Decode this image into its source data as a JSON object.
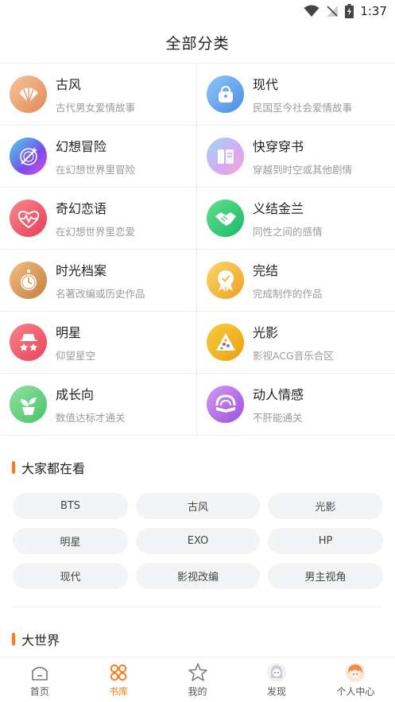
{
  "status_bar": {
    "time": "1:37"
  },
  "header": {
    "title": "全部分类"
  },
  "categories": [
    {
      "title": "古风",
      "desc": "古代男女爱情故事",
      "icon": "shell-icon",
      "color": "#f0a070"
    },
    {
      "title": "现代",
      "desc": "民国至今社会爱情故事",
      "icon": "handbag-icon",
      "color": "#6aaef0"
    },
    {
      "title": "幻想冒险",
      "desc": "在幻想世界里冒险",
      "icon": "magic-circle-icon",
      "color": "#6a5cf0"
    },
    {
      "title": "快穿穿书",
      "desc": "穿越到时空或其他剧情",
      "icon": "books-icon",
      "color": "#c9a8f0"
    },
    {
      "title": "奇幻恋语",
      "desc": "在幻想世界里恋爱",
      "icon": "heartbeat-icon",
      "color": "#f05a6a"
    },
    {
      "title": "义结金兰",
      "desc": "同性之间的感情",
      "icon": "handshake-icon",
      "color": "#3ed07a"
    },
    {
      "title": "时光档案",
      "desc": "名著改编或历史作品",
      "icon": "pocket-watch-icon",
      "color": "#d89a58"
    },
    {
      "title": "完结",
      "desc": "完成制作的作品",
      "icon": "medal-icon",
      "color": "#f5b930"
    },
    {
      "title": "明星",
      "desc": "仰望星空",
      "icon": "star-hat-icon",
      "color": "#f06470"
    },
    {
      "title": "光影",
      "desc": "影视ACG音乐合区",
      "icon": "palette-icon",
      "color": "#f0b428"
    },
    {
      "title": "成长向",
      "desc": "数值达标才通关",
      "icon": "sprout-icon",
      "color": "#6ad07a"
    },
    {
      "title": "动人情感",
      "desc": "不肝能通关",
      "icon": "rainbow-book-icon",
      "color": "#b070e0"
    }
  ],
  "popular": {
    "title": "大家都在看",
    "tags": [
      "BTS",
      "古风",
      "光影",
      "明星",
      "EXO",
      "HP",
      "现代",
      "影视改编",
      "男主视角"
    ]
  },
  "world": {
    "title": "大世界"
  },
  "tabbar": {
    "items": [
      {
        "label": "首页",
        "icon": "home-icon"
      },
      {
        "label": "书库",
        "icon": "library-icon"
      },
      {
        "label": "我的",
        "icon": "star-outline-icon"
      },
      {
        "label": "发现",
        "icon": "discover-avatar-icon"
      },
      {
        "label": "个人中心",
        "icon": "profile-avatar-icon"
      }
    ],
    "active_index": 1,
    "accent_color": "#ff7a1a"
  }
}
